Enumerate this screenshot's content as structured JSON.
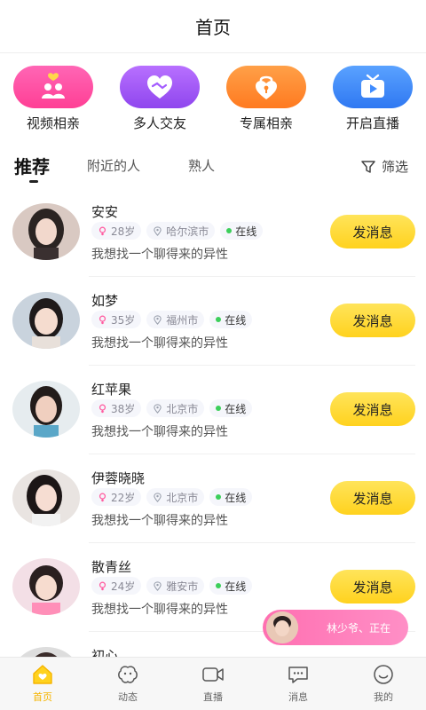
{
  "header": {
    "title": "首页"
  },
  "quick_actions": [
    {
      "label": "视频相亲",
      "icon": "couple-heart-icon",
      "color": "#ff4fa3"
    },
    {
      "label": "多人交友",
      "icon": "handshake-heart-icon",
      "color": "#a45cff"
    },
    {
      "label": "专属相亲",
      "icon": "heart-lock-icon",
      "color": "#ff8a2b"
    },
    {
      "label": "开启直播",
      "icon": "tv-play-icon",
      "color": "#3f8cff"
    }
  ],
  "tabs": [
    {
      "label": "推荐",
      "active": true
    },
    {
      "label": "附近的人",
      "active": false
    },
    {
      "label": "熟人",
      "active": false
    }
  ],
  "filter_label": "筛选",
  "users": [
    {
      "name": "安安",
      "age": "28岁",
      "city": "哈尔滨市",
      "status": "在线",
      "bio": "我想找一个聊得来的异性",
      "button": "发消息"
    },
    {
      "name": "如梦",
      "age": "35岁",
      "city": "福州市",
      "status": "在线",
      "bio": "我想找一个聊得来的异性",
      "button": "发消息"
    },
    {
      "name": "红苹果",
      "age": "38岁",
      "city": "北京市",
      "status": "在线",
      "bio": "我想找一个聊得来的异性",
      "button": "发消息"
    },
    {
      "name": "伊蓉晓晓",
      "age": "22岁",
      "city": "北京市",
      "status": "在线",
      "bio": "我想找一个聊得来的异性",
      "button": "发消息"
    },
    {
      "name": "散青丝",
      "age": "24岁",
      "city": "雅安市",
      "status": "在线",
      "bio": "我想找一个聊得来的异性",
      "button": "发消息"
    },
    {
      "name": "初心",
      "age": "",
      "city": "",
      "status": "",
      "bio": "",
      "button": ""
    }
  ],
  "toast": {
    "text": "林少爷、正在"
  },
  "tabbar": [
    {
      "label": "首页",
      "icon": "home-heart-icon",
      "active": true
    },
    {
      "label": "动态",
      "icon": "moments-icon",
      "active": false
    },
    {
      "label": "直播",
      "icon": "video-camera-icon",
      "active": false
    },
    {
      "label": "消息",
      "icon": "chat-bubble-icon",
      "active": false
    },
    {
      "label": "我的",
      "icon": "smile-face-icon",
      "active": false
    }
  ],
  "colors": {
    "accent_yellow": "#ffd21e",
    "online_green": "#3ccf5a",
    "active_tab": "#f5b400"
  }
}
